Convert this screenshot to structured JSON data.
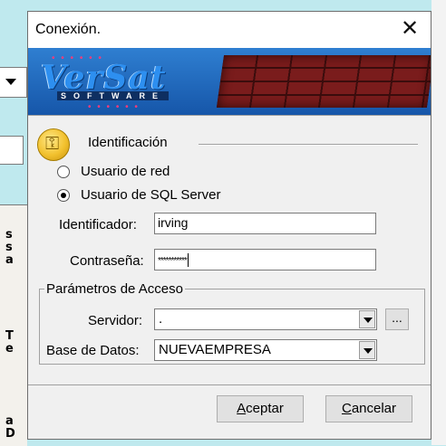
{
  "dialog": {
    "title": "Conexión.",
    "close_glyph": "✕",
    "banner": {
      "logo_text": "VerSat",
      "logo_sub": "SOFTWARE"
    },
    "identification": {
      "group_title": "Identificación",
      "radio_network": "Usuario de red",
      "radio_sql": "Usuario de SQL Server",
      "selected": "sql",
      "identifier_label": "Identificador:",
      "identifier_value": "irving",
      "password_label": "Contraseña:",
      "password_value": "***********"
    },
    "access": {
      "legend": "Parámetros de Acceso",
      "server_label": "Servidor:",
      "server_value": ".",
      "browse_label": "...",
      "database_label": "Base de Datos:",
      "database_value": "NUEVAEMPRESA"
    },
    "buttons": {
      "accept_accel": "A",
      "accept_rest": "ceptar",
      "cancel_accel": "C",
      "cancel_rest": "ancelar"
    }
  },
  "background": {
    "letters_1": [
      "s",
      "s",
      "a"
    ],
    "letters_2": [
      "T",
      "e"
    ],
    "letters_3": [
      "a",
      "D"
    ]
  },
  "icons": {
    "key": "key-icon",
    "close": "close-icon",
    "dropdown": "chevron-down-icon"
  }
}
